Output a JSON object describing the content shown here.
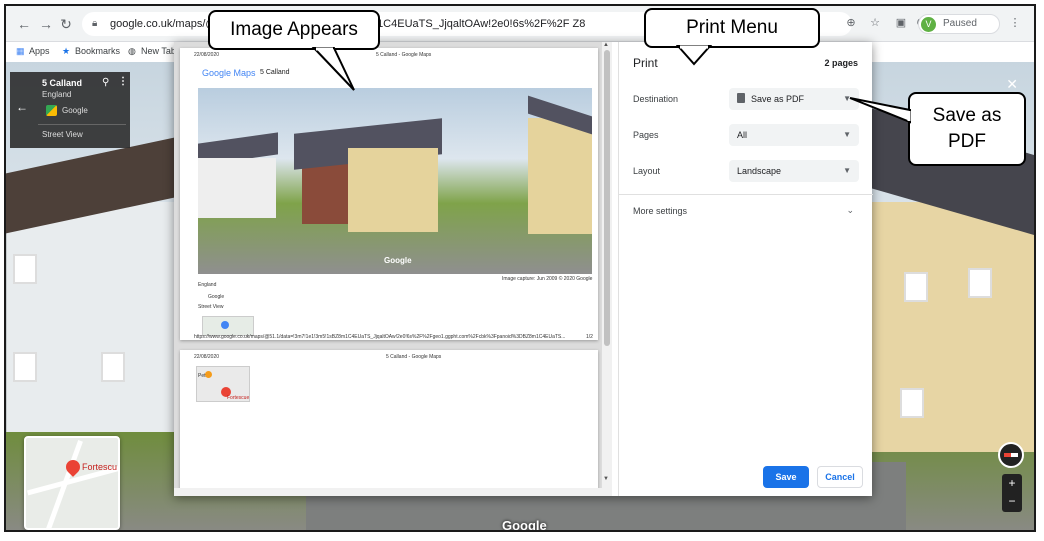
{
  "browser": {
    "url": "google.co.uk/maps/@51.                                  data=!3m7!1e1!3m5!1sBZ8m1C4EUaTS_JjqaltOAw!2e0!6s%2F%2F                               Z8",
    "profile_initial": "V",
    "profile_status": "Paused"
  },
  "bookmarks": {
    "apps": "Apps",
    "bookmarks": "Bookmarks",
    "new_tab": "New Tab"
  },
  "street_view": {
    "place": "5 Calland",
    "region": "England",
    "provider": "Google",
    "mode": "Street View",
    "watermark": "Google",
    "minimap_label": "Fortescu",
    "zoom_in": "+",
    "zoom_out": "−"
  },
  "print_preview": {
    "page1": {
      "date": "22/08/2020",
      "header": "5 Calland - Google Maps",
      "logo": "Google Maps",
      "place": "5 Calland",
      "photo_watermark": "Google",
      "capture_note": "Image capture: Jun 2009    © 2020 Google",
      "region": "England",
      "provider": "Google",
      "mode": "Street View",
      "url_line": "https://www.google.co.uk/maps/@51.1/data=!3m7!1e1!3m5!1sBZ8m1C4EUaTS_JjqaltOAw!2e0!6s%2F%2Fgeo1.ggpht.com%2Fcbk%3Fpanoid%3DBZ8m1C4EUaTS...",
      "page_number": "1/2"
    },
    "page2": {
      "date": "22/08/2020",
      "header": "5 Calland - Google Maps",
      "map_label_a": "Pet",
      "map_label_b": "Fortescue"
    }
  },
  "print_settings": {
    "title": "Print",
    "page_count": "2 pages",
    "destination_label": "Destination",
    "destination_value": "Save as PDF",
    "pages_label": "Pages",
    "pages_value": "All",
    "layout_label": "Layout",
    "layout_value": "Landscape",
    "more_settings": "More settings",
    "save": "Save",
    "cancel": "Cancel"
  },
  "callouts": {
    "image_appears": "Image Appears",
    "print_menu": "Print Menu",
    "save_as_pdf_line1": "Save as",
    "save_as_pdf_line2": "PDF"
  },
  "colors": {
    "accent": "#1a73e8",
    "profile_green": "#5fb143"
  }
}
